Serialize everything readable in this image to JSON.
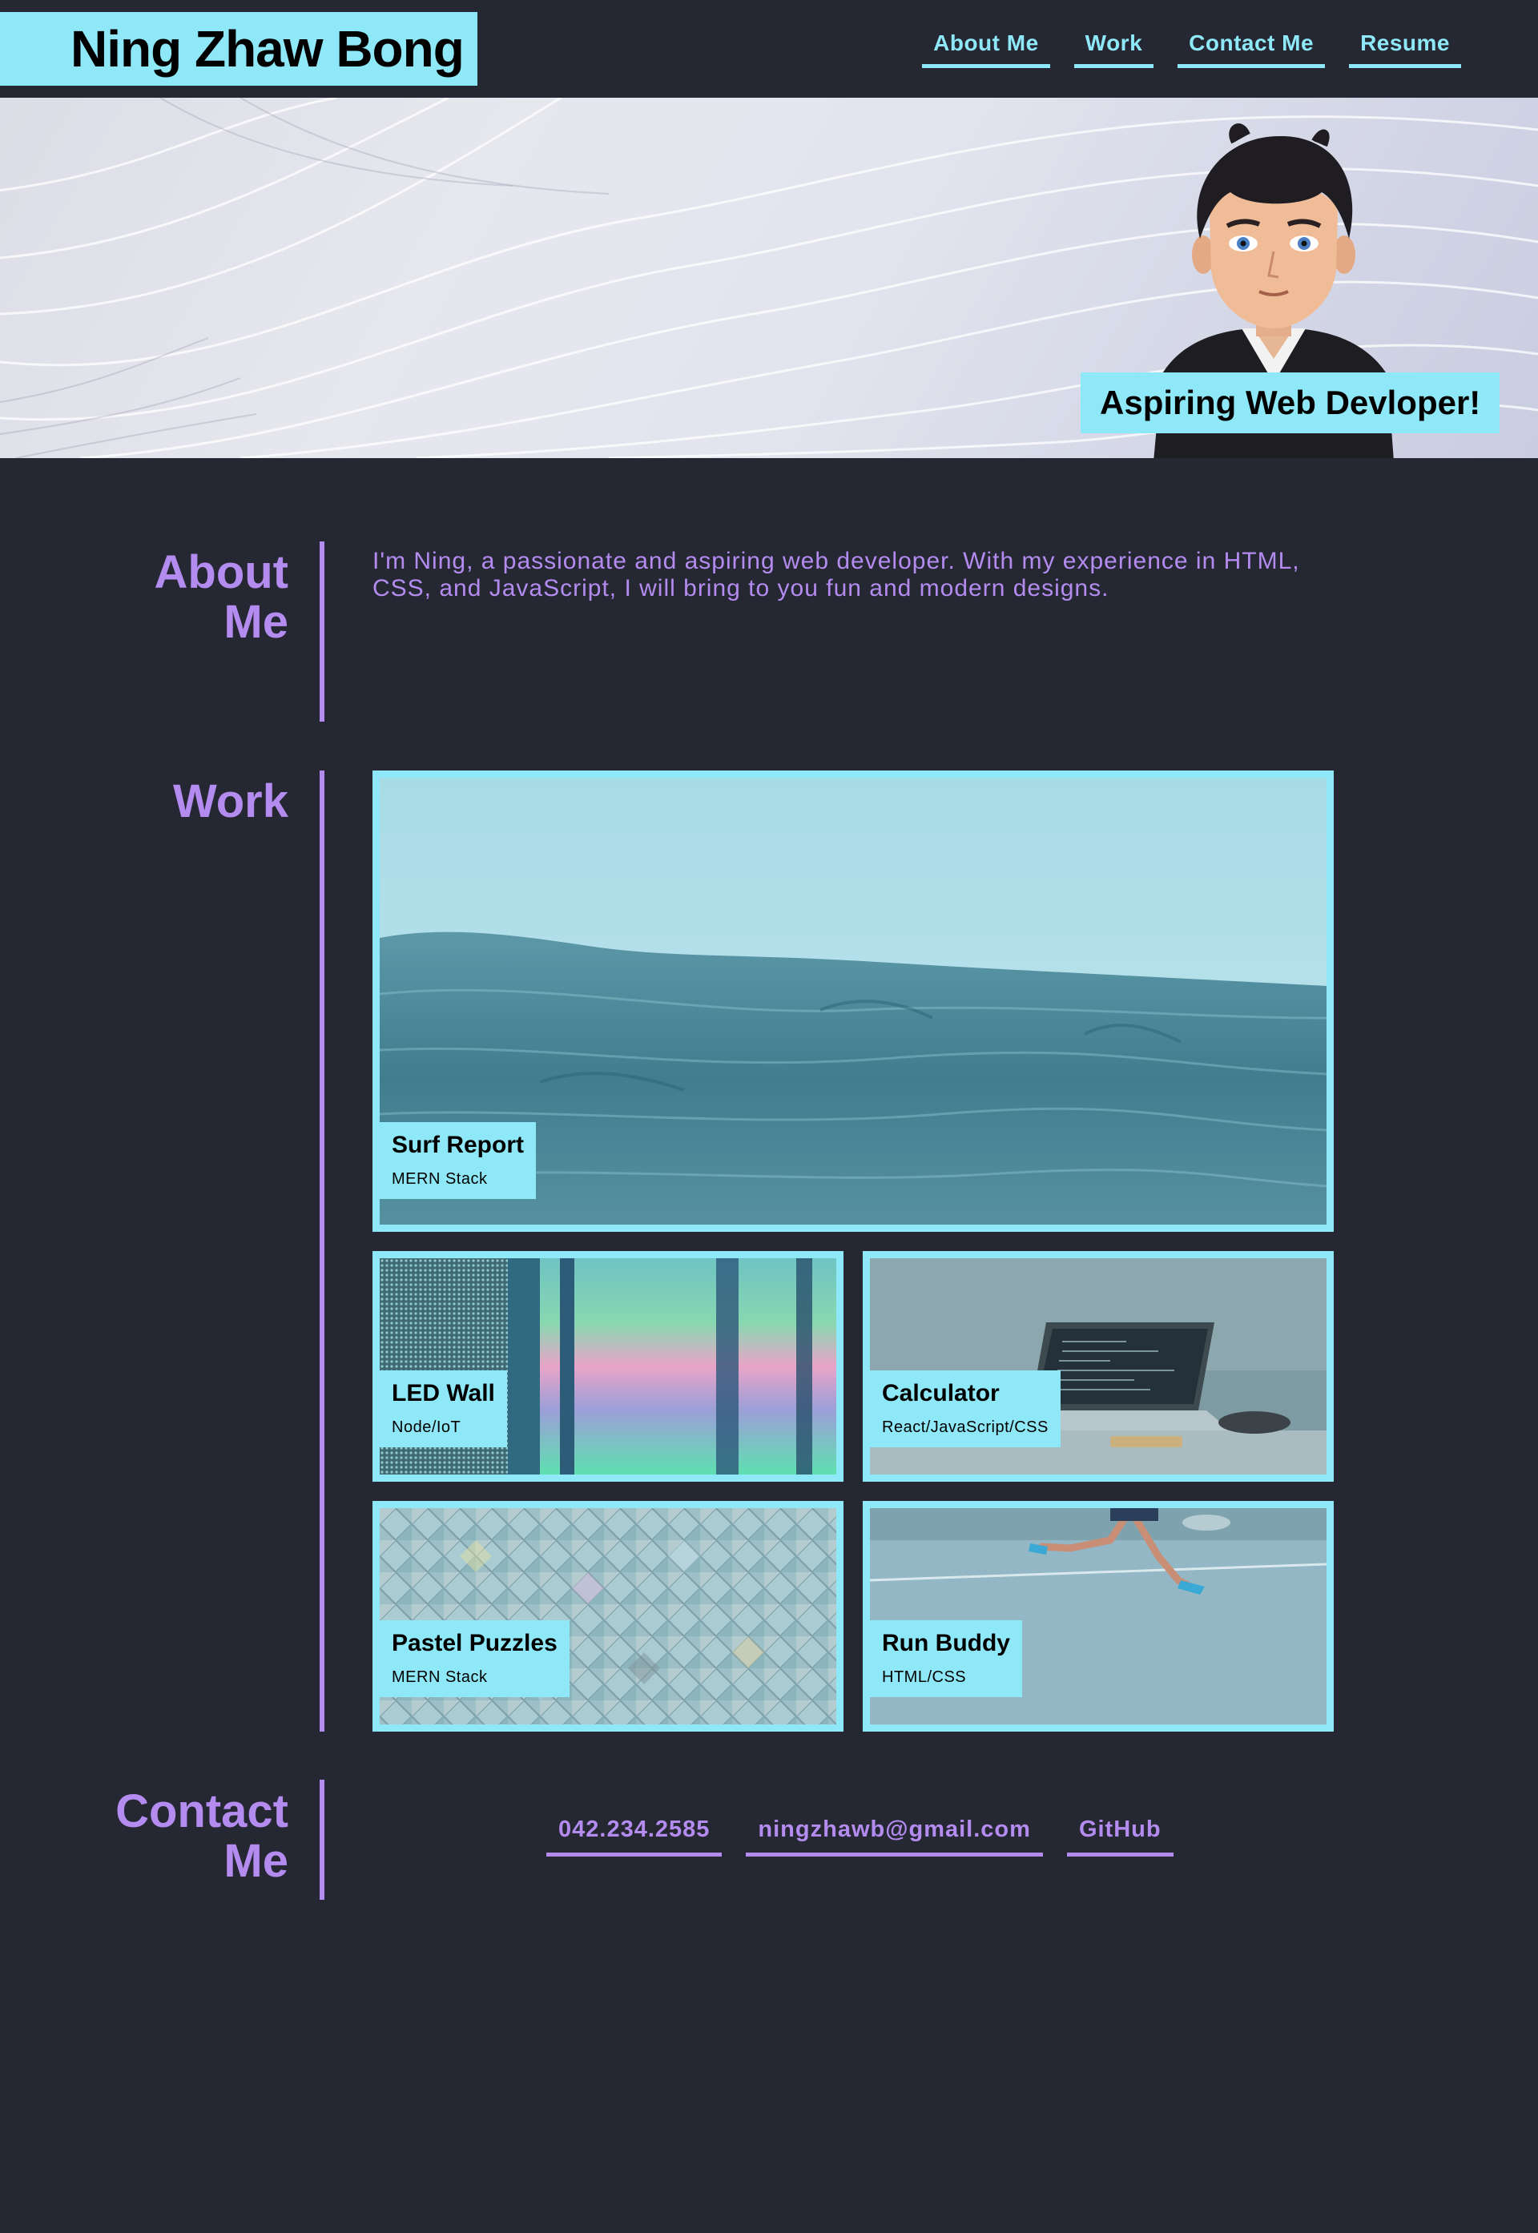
{
  "header": {
    "brand": "Ning Zhaw Bong",
    "nav": [
      {
        "label": "About Me"
      },
      {
        "label": "Work"
      },
      {
        "label": "Contact Me"
      },
      {
        "label": "Resume"
      }
    ]
  },
  "hero": {
    "tagline": "Aspiring Web Devloper!"
  },
  "about": {
    "title_line1": "About",
    "title_line2": "Me",
    "text": "I'm Ning, a passionate and aspiring web developer. With my experience in HTML, CSS, and JavaScript, I will bring to you fun and modern designs."
  },
  "work": {
    "title": "Work",
    "projects": [
      {
        "name": "Surf Report",
        "stack": "MERN Stack"
      },
      {
        "name": "LED Wall",
        "stack": "Node/IoT"
      },
      {
        "name": "Calculator",
        "stack": "React/JavaScript/CSS"
      },
      {
        "name": "Pastel Puzzles",
        "stack": "MERN Stack"
      },
      {
        "name": "Run Buddy",
        "stack": "HTML/CSS"
      }
    ]
  },
  "contact": {
    "title_line1": "Contact",
    "title_line2": "Me",
    "links": [
      {
        "label": "042.234.2585"
      },
      {
        "label": "ningzhawb@gmail.com"
      },
      {
        "label": "GitHub"
      }
    ]
  },
  "colors": {
    "background": "#252733",
    "accent_cyan": "#8ee8f7",
    "accent_purple": "#b48cf0"
  }
}
